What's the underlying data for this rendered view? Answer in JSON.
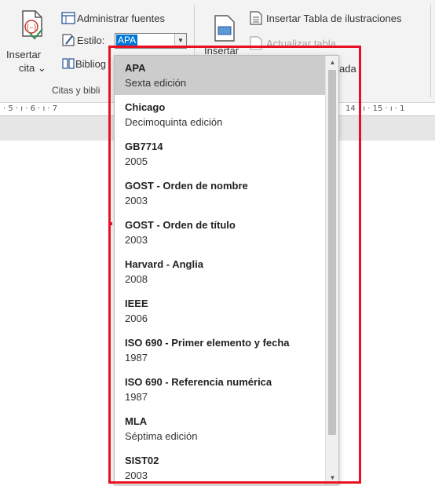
{
  "ribbon": {
    "insert_citation": {
      "line1": "Insertar",
      "line2": "cita",
      "arrow": "⌄"
    },
    "manage_sources": "Administrar fuentes",
    "style_label": "Estilo:",
    "style_value": "APA",
    "bibliography": "Bibliog",
    "group_label": "Citas y bibli",
    "insert_caption_partial": "Insertar",
    "insert_table_of_figures": "Insertar Tabla de ilustraciones",
    "update_table": "Actualizar tabla",
    "cross_reference_partial": "ada"
  },
  "ruler": {
    "left_marks": "· 5 · ı · 6 · ı · 7",
    "right_marks": "14 · ı · 15 · ı · 1"
  },
  "dropdown": {
    "items": [
      {
        "title": "APA",
        "subtitle": "Sexta edición",
        "selected": true
      },
      {
        "title": "Chicago",
        "subtitle": "Decimoquinta edición"
      },
      {
        "title": "GB7714",
        "subtitle": "2005"
      },
      {
        "title": "GOST - Orden de nombre",
        "subtitle": "2003"
      },
      {
        "title": "GOST - Orden de título",
        "subtitle": "2003"
      },
      {
        "title": "Harvard - Anglia",
        "subtitle": "2008"
      },
      {
        "title": "IEEE",
        "subtitle": "2006"
      },
      {
        "title": "ISO 690 - Primer elemento y fecha",
        "subtitle": "1987"
      },
      {
        "title": "ISO 690 - Referencia numérica",
        "subtitle": "1987"
      },
      {
        "title": "MLA",
        "subtitle": "Séptima edición"
      },
      {
        "title": "SIST02",
        "subtitle": "2003"
      }
    ]
  },
  "colors": {
    "highlight_border": "#e81123",
    "selected_bg": "#cccccc",
    "combo_selection": "#0078d7"
  },
  "icons": [
    "insert-citation-icon",
    "manage-sources-icon",
    "style-icon",
    "bibliography-icon",
    "insert-caption-icon",
    "table-of-figures-icon",
    "update-table-icon"
  ]
}
